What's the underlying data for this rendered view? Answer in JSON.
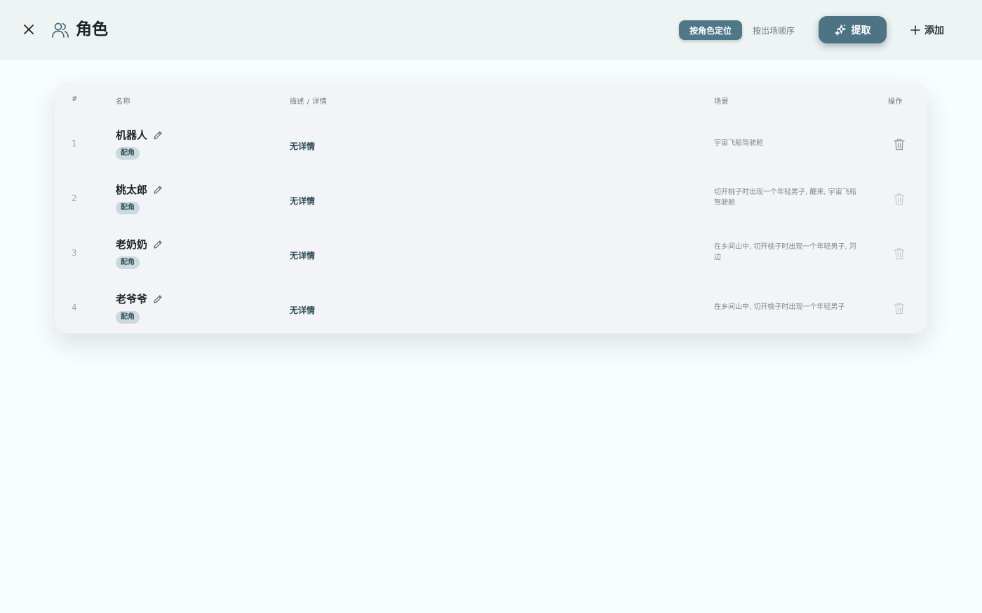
{
  "header": {
    "title": "角色",
    "close_icon": "close-icon",
    "title_icon": "users-icon",
    "view_modes": [
      "按角色定位",
      "按出场顺序"
    ],
    "active_view": "按角色定位",
    "extract_label": "提取",
    "add_label": "添加"
  },
  "table": {
    "columns": {
      "index": "#",
      "name": "名称",
      "desc": "描述 / 详情",
      "scene": "场景",
      "actions": "操作"
    },
    "rows": [
      {
        "index": "1",
        "name": "机器人",
        "role": "配角",
        "desc": "无详情",
        "scene": "宇宙飞船驾驶舱"
      },
      {
        "index": "2",
        "name": "桃太郎",
        "role": "配角",
        "desc": "无详情",
        "scene": "切开桃子时出现一个年轻男子, 醒来, 宇宙飞船驾驶舱"
      },
      {
        "index": "3",
        "name": "老奶奶",
        "role": "配角",
        "desc": "无详情",
        "scene": "在乡间山中, 切开桃子时出现一个年轻男子, 河边"
      },
      {
        "index": "4",
        "name": "老爷爷",
        "role": "配角",
        "desc": "无详情",
        "scene": "在乡间山中, 切开桃子时出现一个年轻男子"
      }
    ]
  },
  "colors": {
    "accent": "#4f7787",
    "badge_bg": "#cbdadf",
    "card_bg": "#f2f4f7",
    "topbar_bg": "#eef3f3"
  }
}
